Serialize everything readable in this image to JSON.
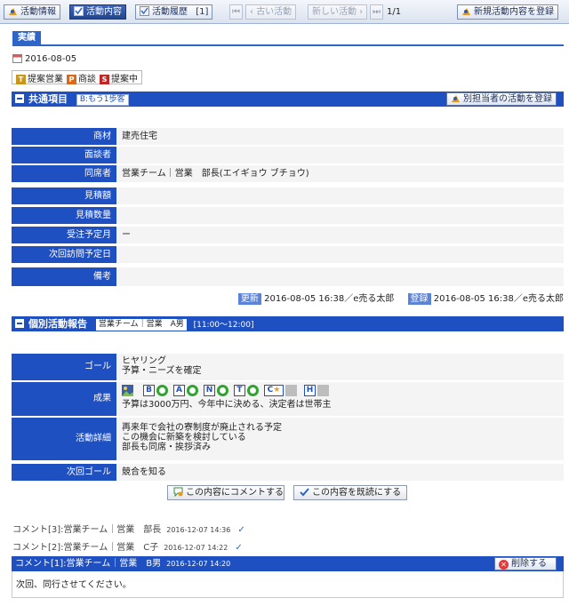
{
  "toolbar": {
    "activity_info": "活動情報",
    "activity_content": "活動内容",
    "activity_history": "活動履歴",
    "history_count": "[1]",
    "older": "古い活動",
    "newer": "新しい活動",
    "page": "1/1",
    "new_register": "新規活動内容を登録"
  },
  "subtab": {
    "label": "実績"
  },
  "activity": {
    "date": "2016-08-05",
    "chips": [
      {
        "letter": "T",
        "label": "提案営業",
        "color": "#c8961e"
      },
      {
        "letter": "P",
        "label": "商談",
        "color": "#d86a1a"
      },
      {
        "letter": "S",
        "label": "提案中",
        "color": "#c02828"
      }
    ]
  },
  "common": {
    "title": "共通項目",
    "tag": "B:もう1歩客",
    "button": "別担当者の活動を登録",
    "fields": [
      {
        "label": "商材",
        "value": "建売住宅"
      },
      {
        "label": "面談者",
        "value": ""
      },
      {
        "label": "同席者",
        "value": "営業チーム｜営業　部長(エイギョウ ブチョウ)"
      },
      {
        "label": "見積額",
        "value": ""
      },
      {
        "label": "見積数量",
        "value": ""
      },
      {
        "label": "受注予定月",
        "value": "ー"
      },
      {
        "label": "次回訪問予定日",
        "value": ""
      },
      {
        "label": "備考",
        "value": ""
      }
    ],
    "update_badge": "更新",
    "update_text": "2016-08-05 16:38／e売る太郎",
    "register_badge": "登録",
    "register_text": "2016-08-05 16:38／e売る太郎"
  },
  "report": {
    "title": "個別活動報告",
    "person": "営業チーム｜営業　A男",
    "time": "[11:00～12:00]",
    "goal_label": "ゴール",
    "goal_lines": [
      "ヒヤリング",
      "予算・ニーズを確定"
    ],
    "result_label": "成果",
    "result_letters": [
      "B",
      "A",
      "N",
      "T",
      "C",
      "H"
    ],
    "result_text": "予算は3000万円、今年中に決める、決定者は世帯主",
    "detail_label": "活動詳細",
    "detail_lines": [
      "再来年で会社の寮制度が廃止される予定",
      "この機会に新築を検討している",
      "部長も同席・挨拶済み"
    ],
    "next_goal_label": "次回ゴール",
    "next_goal": "競合を知る"
  },
  "actions": {
    "comment": "この内容にコメントする",
    "read": "この内容を既読にする"
  },
  "comments": [
    {
      "label": "コメント[3]:営業チーム｜営業　部長",
      "time": "2016-12-07 14:36"
    },
    {
      "label": "コメント[2]:営業チーム｜営業　C子",
      "time": "2016-12-07 14:22"
    }
  ],
  "comment1": {
    "label": "コメント[1]:営業チーム｜営業　B男",
    "time": "2016-12-07 14:20",
    "delete": "削除する",
    "body": "次回、同行させてください。"
  }
}
